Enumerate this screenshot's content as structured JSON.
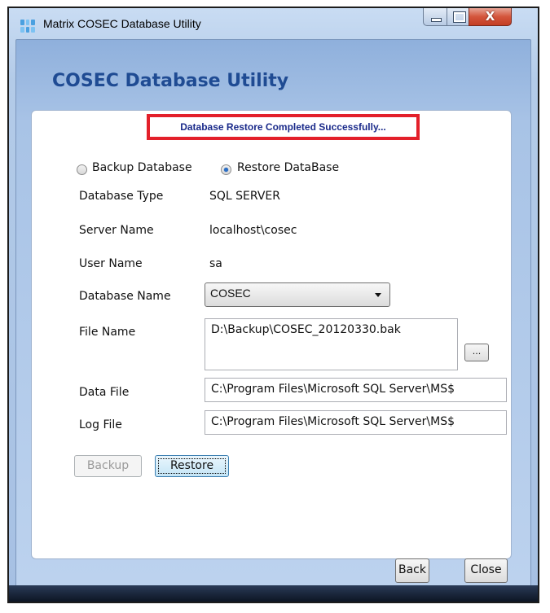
{
  "window": {
    "title": "Matrix COSEC Database Utility",
    "icon": "app-grid-icon",
    "controls": {
      "minimize_icon": "minimize-icon",
      "maximize_icon": "maximize-icon",
      "close_glyph": "X"
    }
  },
  "header": {
    "title": "COSEC Database Utility"
  },
  "status": {
    "message": "Database Restore Completed Successfully..."
  },
  "mode": {
    "options": [
      {
        "label": "Backup Database",
        "selected": false
      },
      {
        "label": "Restore DataBase",
        "selected": true
      }
    ]
  },
  "info": {
    "db_type_label": "Database Type",
    "db_type_value": "SQL SERVER",
    "server_label": "Server Name",
    "server_value": "localhost\\cosec",
    "user_label": "User Name",
    "user_value": "sa"
  },
  "database": {
    "label": "Database Name",
    "selected": "COSEC"
  },
  "file": {
    "label": "File Name",
    "value": "D:\\Backup\\COSEC_20120330.bak",
    "browse_label": "..."
  },
  "data_file": {
    "label": "Data File",
    "value": "C:\\Program Files\\Microsoft SQL Server\\MS$"
  },
  "log_file": {
    "label": "Log File",
    "value": "C:\\Program Files\\Microsoft SQL Server\\MS$"
  },
  "actions": {
    "backup_label": "Backup",
    "restore_label": "Restore"
  },
  "footer": {
    "back_label": "Back",
    "close_label": "Close"
  },
  "colors": {
    "heading": "#1f4b93",
    "status_text": "#1a2a8a",
    "status_border": "#e3202a"
  }
}
